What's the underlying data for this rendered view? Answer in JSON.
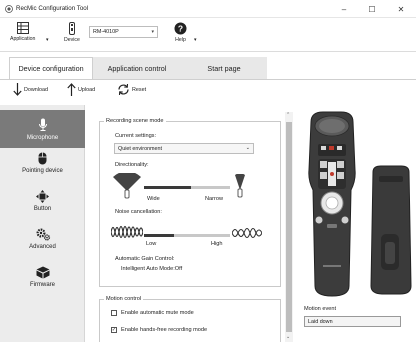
{
  "window": {
    "title": "RecMic Configuration Tool",
    "minimize": "–",
    "maximize": "☐",
    "close": "✕"
  },
  "toolbar": {
    "application_label": "Application",
    "device_label": "Device",
    "model": "RM-4010P",
    "help_label": "Help"
  },
  "tabs": [
    "Device configuration",
    "Application control",
    "Start page"
  ],
  "actions": {
    "download": "Download",
    "upload": "Upload",
    "reset": "Reset"
  },
  "sidebar": {
    "items": [
      {
        "label": "Microphone",
        "icon": "microphone-icon",
        "active": true
      },
      {
        "label": "Pointing device",
        "icon": "mouse-icon",
        "active": false
      },
      {
        "label": "Button",
        "icon": "button-icon",
        "active": false
      },
      {
        "label": "Advanced",
        "icon": "gears-icon",
        "active": false
      },
      {
        "label": "Firmware",
        "icon": "firmware-icon",
        "active": false
      }
    ]
  },
  "recording": {
    "group_title": "Recording scene mode",
    "current_settings_label": "Current settings:",
    "current_settings_value": "Quiet environment",
    "directionality_label": "Directionality:",
    "wide_label": "Wide",
    "narrow_label": "Narrow",
    "directionality_level": 0.55,
    "noise_label": "Noise cancellation:",
    "low_label": "Low",
    "high_label": "High",
    "noise_level": 0.35,
    "agc_label": "Automatic Gain Control:",
    "agc_value": "Intelligent Auto Mode:Off"
  },
  "motion": {
    "group_title": "Motion control",
    "auto_mute_label": "Enable automatic mute mode",
    "auto_mute_checked": false,
    "handsfree_label": "Enable hands-free recording mode",
    "handsfree_checked": true
  },
  "right": {
    "motion_event_label": "Motion event",
    "motion_event_value": "Laid down"
  },
  "colors": {
    "sidebar_active": "#7a7a7a",
    "device_body": "#3c3c3c",
    "device_accent_red": "#c0392b"
  }
}
